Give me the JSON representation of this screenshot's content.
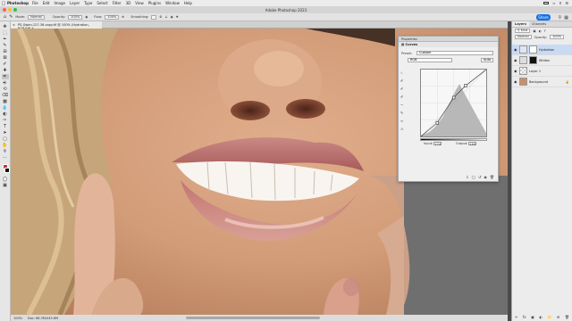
{
  "menubar": {
    "app": "Photoshop",
    "items": [
      "File",
      "Edit",
      "Image",
      "Layer",
      "Type",
      "Select",
      "Filter",
      "3D",
      "View",
      "Plugins",
      "Window",
      "Help"
    ],
    "status_icons": [
      "battery-icon",
      "wifi-icon",
      "search-icon",
      "control-center-icon"
    ],
    "status_time": ""
  },
  "titlebar": {
    "title": "Adobe Photoshop 2023"
  },
  "options": {
    "mode_label": "Mode:",
    "mode_value": "Normal",
    "opacity_label": "Opacity:",
    "opacity_value": "100%",
    "flow_label": "Flow:",
    "flow_value": "100%",
    "smoothing_label": "Smoothing:",
    "smoothing_value": "",
    "share_label": "Share"
  },
  "document_tab": {
    "label": "PS-Gwen-127-36-copy.tif @ 100% (Hydration, RGB/16) *"
  },
  "properties": {
    "tab": "Properties",
    "adjustment": "Curves",
    "preset_label": "Preset:",
    "preset_value": "Custom",
    "channel_value": "RGB",
    "auto_label": "Auto",
    "input_label": "Input:",
    "input_value": "174",
    "output_label": "Output:",
    "output_value": "193"
  },
  "curves_data": {
    "histogram": [
      2,
      3,
      3,
      4,
      5,
      6,
      7,
      8,
      10,
      12,
      14,
      16,
      18,
      21,
      24,
      26,
      29,
      32,
      35,
      40,
      44,
      48,
      52,
      58,
      62,
      66,
      72,
      76,
      80,
      85,
      88,
      92,
      95,
      90,
      86,
      82,
      78,
      74,
      70,
      66,
      62,
      58,
      54,
      50,
      46,
      42,
      38,
      34,
      30,
      26,
      22,
      18,
      14,
      10,
      6
    ],
    "curve_points": [
      [
        0,
        0
      ],
      [
        64,
        52
      ],
      [
        128,
        148
      ],
      [
        174,
        193
      ],
      [
        255,
        255
      ]
    ]
  },
  "layers_panel": {
    "tabs": [
      "Layers",
      "Channels"
    ],
    "kind_label": "Kind",
    "mode_value": "Normal",
    "opacity_label": "Opacity:",
    "opacity_value": "100%",
    "layers": [
      {
        "name": "Hydration",
        "selected": true,
        "has_mask": true
      },
      {
        "name": "Whiten",
        "selected": false,
        "has_mask": true
      },
      {
        "name": "Layer 1",
        "selected": false,
        "has_mask": false
      },
      {
        "name": "Background",
        "selected": false,
        "has_mask": false
      }
    ]
  },
  "statusbar": {
    "zoom": "100%",
    "doc_info": "Doc: 86.3M/445.8M"
  },
  "colors": {
    "accent": "#1473e6",
    "foreground_swatch": "#c23a3a",
    "background_swatch": "#111111"
  }
}
